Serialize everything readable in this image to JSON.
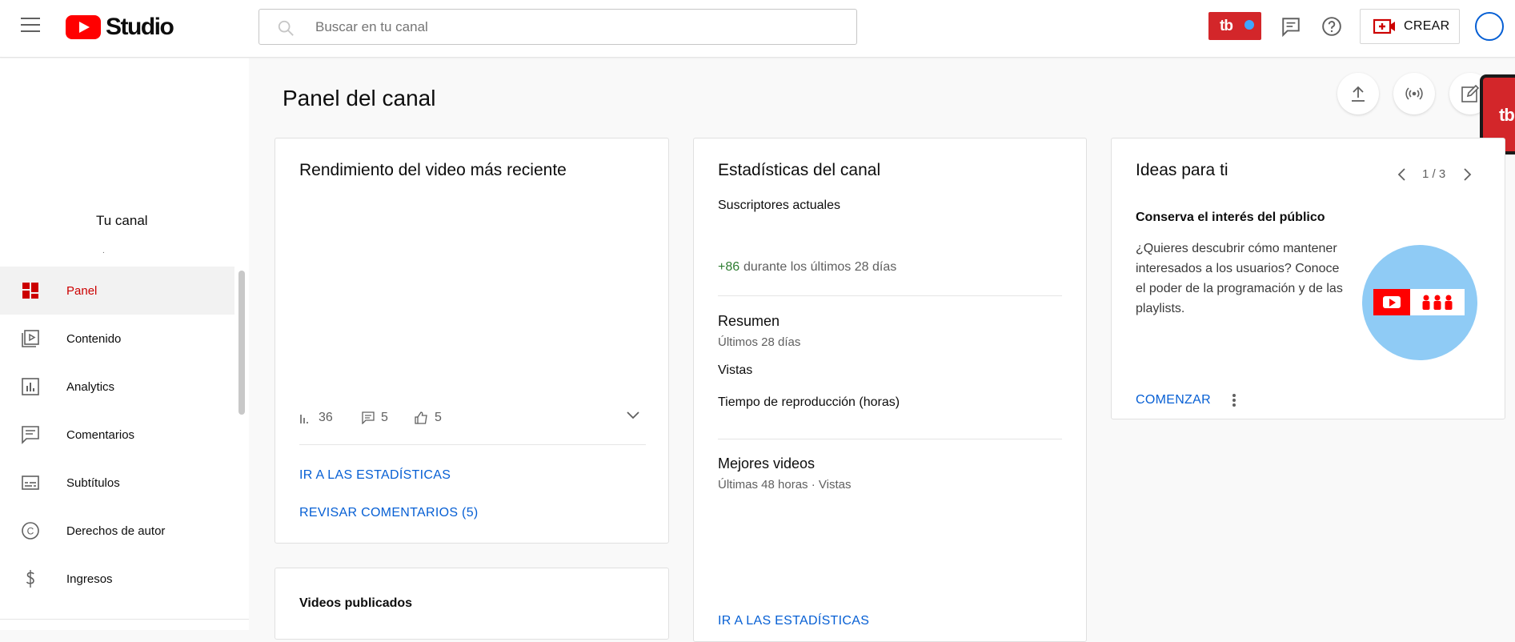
{
  "header": {
    "logo_text": "Studio",
    "search_placeholder": "Buscar en tu canal",
    "create_label": "CREAR",
    "tb_label": "tb"
  },
  "sidebar": {
    "channel_label": "Tu canal",
    "channel_sub": ".",
    "items": [
      {
        "label": "Panel",
        "icon": "dashboard-icon",
        "active": true
      },
      {
        "label": "Contenido",
        "icon": "content-icon"
      },
      {
        "label": "Analytics",
        "icon": "analytics-icon"
      },
      {
        "label": "Comentarios",
        "icon": "comments-icon"
      },
      {
        "label": "Subtítulos",
        "icon": "subtitles-icon"
      },
      {
        "label": "Derechos de autor",
        "icon": "copyright-icon"
      },
      {
        "label": "Ingresos",
        "icon": "dollar-icon"
      }
    ]
  },
  "main": {
    "title": "Panel del canal",
    "latest_video": {
      "title": "Rendimiento del video más reciente",
      "views": "36",
      "comments": "5",
      "likes": "5",
      "link_stats": "IR A LAS ESTADÍSTICAS",
      "link_comments": "REVISAR COMENTARIOS (5)"
    },
    "published": {
      "title": "Videos publicados"
    },
    "channel_stats": {
      "title": "Estadísticas del canal",
      "subs_label": "Suscriptores actuales",
      "subs_delta": "+86",
      "subs_delta_text": "durante los últimos 28 días",
      "summary_title": "Resumen",
      "summary_period": "Últimos 28 días",
      "views_label": "Vistas",
      "watch_label": "Tiempo de reproducción (horas)",
      "top_title": "Mejores videos",
      "top_period": "Últimas 48 horas · Vistas",
      "link_stats": "IR A LAS ESTADÍSTICAS"
    },
    "ideas": {
      "title": "Ideas para ti",
      "pager": "1 / 3",
      "subtitle": "Conserva el interés del público",
      "body": "¿Quieres descubrir cómo mantener interesados a los usuarios? Conoce el poder de la programación y de las playlists.",
      "cta": "COMENZAR"
    }
  },
  "colors": {
    "accent_red": "#cc0000",
    "link_blue": "#065fd4",
    "positive_green": "#2e7d32",
    "tb_red": "#d3262a"
  }
}
